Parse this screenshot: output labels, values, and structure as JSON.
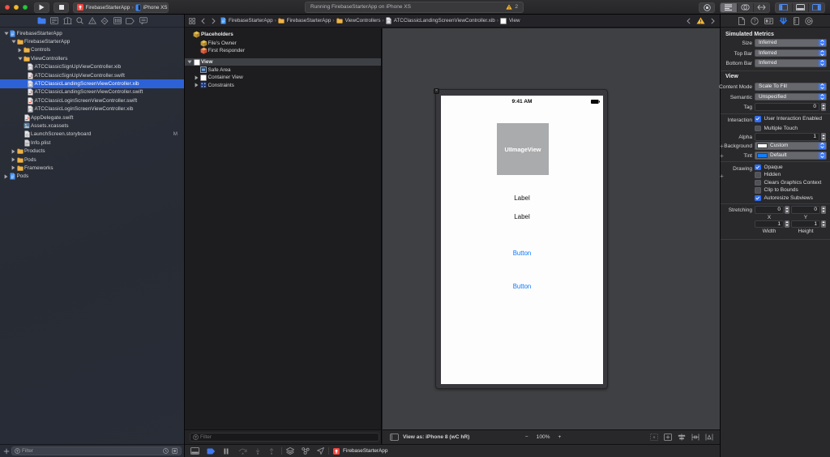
{
  "toolbar": {
    "play_button": "play",
    "stop_button": "stop",
    "scheme_app": "FirebaseStarterApp",
    "scheme_separator": "›",
    "scheme_device": "iPhone XS",
    "status_text": "Running FirebaseStarterApp on iPhone XS",
    "warning_count": "2"
  },
  "colors": {
    "selection_blue": "#2d61d6",
    "accent_blue": "#3b78f7",
    "ios_button_blue": "#0a7aff",
    "warning_yellow": "#f7b731",
    "canvas_gray": "#3e4043",
    "background_swatch": "#ffffff",
    "tint_swatch": "#157dfb"
  },
  "navigator": {
    "filter_placeholder": "Filter",
    "tree": [
      {
        "label": "FirebaseStarterApp",
        "level": 0,
        "icon": "project",
        "disclosure": "open"
      },
      {
        "label": "FirebaseStarterApp",
        "level": 1,
        "icon": "folder",
        "disclosure": "open"
      },
      {
        "label": "Controls",
        "level": 2,
        "icon": "folder",
        "disclosure": "closed"
      },
      {
        "label": "ViewControllers",
        "level": 2,
        "icon": "folder",
        "disclosure": "open"
      },
      {
        "label": "ATCClassicSignUpViewController.xib",
        "level": 3,
        "icon": "xib"
      },
      {
        "label": "ATCClassicSignUpViewController.swift",
        "level": 3,
        "icon": "swift"
      },
      {
        "label": "ATCClassicLandingScreenViewController.xib",
        "level": 3,
        "icon": "xib",
        "selected": true
      },
      {
        "label": "ATCClassicLandingScreenViewController.swift",
        "level": 3,
        "icon": "swift"
      },
      {
        "label": "ATCClassicLoginScreenViewController.swift",
        "level": 3,
        "icon": "swift"
      },
      {
        "label": "ATCClassicLoginScreenViewController.xib",
        "level": 3,
        "icon": "xib"
      },
      {
        "label": "AppDelegate.swift",
        "level": 2,
        "icon": "swift"
      },
      {
        "label": "Assets.xcassets",
        "level": 2,
        "icon": "assets"
      },
      {
        "label": "LaunchScreen.storyboard",
        "level": 2,
        "icon": "storyboard",
        "badge": "M"
      },
      {
        "label": "Info.plist",
        "level": 2,
        "icon": "plist"
      },
      {
        "label": "Products",
        "level": 1,
        "icon": "folder",
        "disclosure": "closed"
      },
      {
        "label": "Pods",
        "level": 1,
        "icon": "folder",
        "disclosure": "closed"
      },
      {
        "label": "Frameworks",
        "level": 1,
        "icon": "folder",
        "disclosure": "closed"
      },
      {
        "label": "Pods",
        "level": 0,
        "icon": "project",
        "disclosure": "closed"
      }
    ]
  },
  "jumpbar": {
    "separator": "›",
    "segments": [
      {
        "label": "FirebaseStarterApp",
        "icon": "project"
      },
      {
        "label": "FirebaseStarterApp",
        "icon": "folder"
      },
      {
        "label": "ViewControllers",
        "icon": "folder"
      },
      {
        "label": "ATCClassicLandingScreenViewController.xib",
        "icon": "xib"
      },
      {
        "label": "View",
        "icon": "view"
      }
    ]
  },
  "outline": {
    "filter_placeholder": "Filter",
    "rows": [
      {
        "label": "Placeholders",
        "icon": "cube-yellow",
        "level": 0,
        "bold": true
      },
      {
        "label": "File's Owner",
        "icon": "cube-yellow",
        "level": 1
      },
      {
        "label": "First Responder",
        "icon": "cube-orange",
        "level": 1
      },
      {
        "label": "View",
        "icon": "view",
        "level": 0,
        "disclosure": "open",
        "selected": true,
        "bold": true
      },
      {
        "label": "Safe Area",
        "icon": "safearea",
        "level": 1
      },
      {
        "label": "Container View",
        "icon": "view",
        "level": 1,
        "disclosure": "closed"
      },
      {
        "label": "Constraints",
        "icon": "constraints",
        "level": 1,
        "disclosure": "closed"
      }
    ]
  },
  "canvas": {
    "status_time": "9:41 AM",
    "image_view_label": "UIImageView",
    "labels": [
      "Label",
      "Label"
    ],
    "buttons": [
      "Button",
      "Button"
    ],
    "bottom_bar": {
      "view_as": "View as: iPhone 8 (wC hR)",
      "minus": "−",
      "zoom": "100%",
      "plus": "+"
    }
  },
  "debugbar": {
    "process": "FirebaseStarterApp"
  },
  "inspector": {
    "simulated_metrics": {
      "title": "Simulated Metrics",
      "rows": [
        {
          "label": "Size",
          "value": "Inferred"
        },
        {
          "label": "Top Bar",
          "value": "Inferred"
        },
        {
          "label": "Bottom Bar",
          "value": "Inferred"
        }
      ]
    },
    "view": {
      "title": "View",
      "content_mode_label": "Content Mode",
      "content_mode_value": "Scale To Fill",
      "semantic_label": "Semantic",
      "semantic_value": "Unspecified",
      "tag_label": "Tag",
      "tag_value": "0",
      "interaction_label": "Interaction",
      "interaction_checkboxes": [
        {
          "label": "User Interaction Enabled",
          "checked": true
        },
        {
          "label": "Multiple Touch",
          "checked": false
        }
      ],
      "alpha_label": "Alpha",
      "alpha_value": "1",
      "background_label": "Background",
      "background_value": "Custom",
      "tint_label": "Tint",
      "tint_value": "Default",
      "drawing_label": "Drawing",
      "drawing_checkboxes": [
        {
          "label": "Opaque",
          "checked": true
        },
        {
          "label": "Hidden",
          "checked": false
        },
        {
          "label": "Clears Graphics Context",
          "checked": false
        },
        {
          "label": "Clip to Bounds",
          "checked": false
        },
        {
          "label": "Autoresize Subviews",
          "checked": true
        }
      ],
      "stretching_label": "Stretching",
      "stretching_fields": [
        {
          "value": "0",
          "axis": "X"
        },
        {
          "value": "0",
          "axis": "Y"
        },
        {
          "value": "1",
          "axis": "Width"
        },
        {
          "value": "1",
          "axis": "Height"
        }
      ]
    }
  }
}
